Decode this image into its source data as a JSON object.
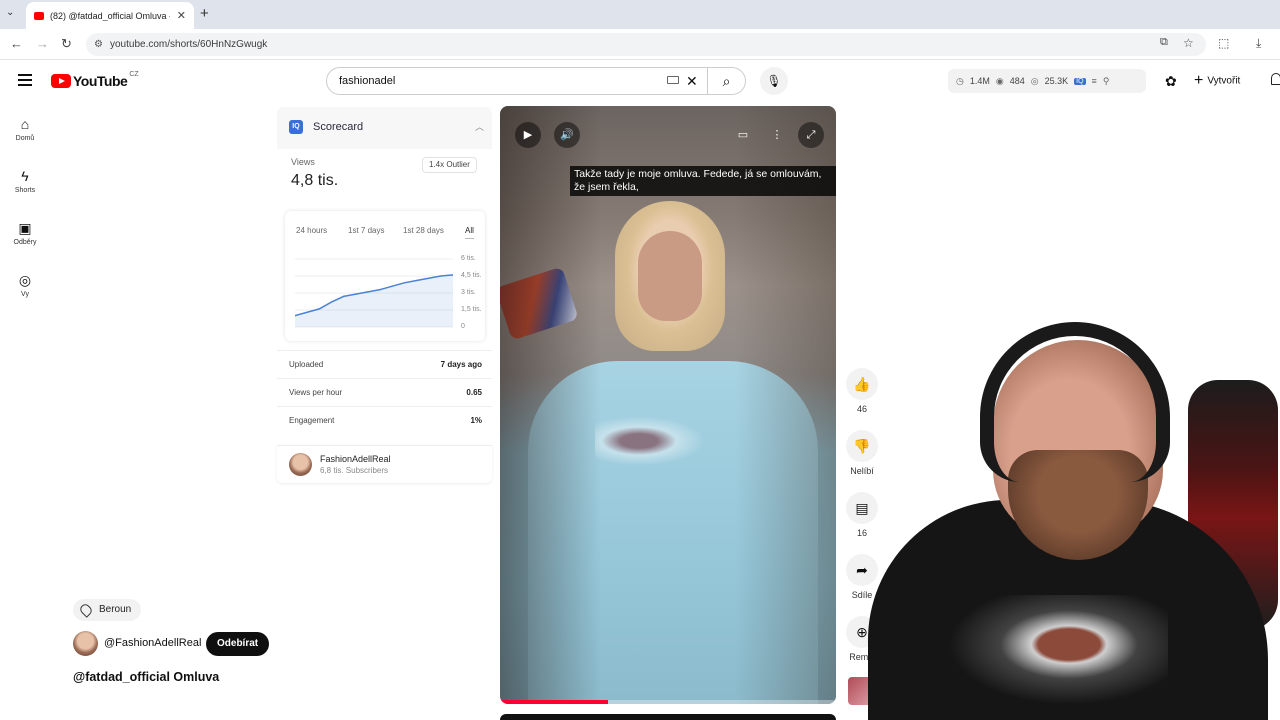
{
  "browser": {
    "tab_title": "(82) @fatdad_official Omluva -",
    "url": "youtube.com/shorts/60HnNzGwugk"
  },
  "header": {
    "logo_text": "YouTube",
    "region": "CZ",
    "search_value": "fashionadel",
    "stats": {
      "views": "1.4M",
      "eye": "484",
      "watch": "25.3K"
    },
    "create_label": "Vytvořit"
  },
  "sidebar": {
    "items": [
      {
        "label": "Domů",
        "icon": "home-icon"
      },
      {
        "label": "Shorts",
        "icon": "shorts-icon"
      },
      {
        "label": "Odběry",
        "icon": "subscriptions-icon"
      },
      {
        "label": "Vy",
        "icon": "you-icon"
      }
    ]
  },
  "scorecard": {
    "title": "Scorecard",
    "views_label": "Views",
    "views_value": "4,8 tis.",
    "outlier": "1.4x Outlier",
    "tabs": [
      "24 hours",
      "1st 7 days",
      "1st 28 days",
      "All"
    ],
    "active_tab": "All",
    "rows": [
      {
        "key": "Uploaded",
        "value": "7 days ago"
      },
      {
        "key": "Views per hour",
        "value": "0.65"
      },
      {
        "key": "Engagement",
        "value": "1%"
      }
    ],
    "channel_name": "FashionAdellReal",
    "channel_subs": "6,8 tis. Subscribers"
  },
  "chart_data": {
    "type": "area",
    "x": [
      1,
      2,
      3,
      4,
      5,
      6,
      7,
      8,
      9,
      10,
      11,
      12,
      13,
      14
    ],
    "series": [
      {
        "values": [
          1.0,
          1.3,
          1.6,
          2.2,
          2.7,
          2.9,
          3.1,
          3.3,
          3.6,
          3.9,
          4.1,
          4.3,
          4.5,
          4.6
        ]
      }
    ],
    "yticks": [
      "6 tis.",
      "4,5 tis.",
      "3 tis.",
      "1,5 tis.",
      "0"
    ],
    "ylim": [
      0,
      6
    ],
    "color": "#4a82d6"
  },
  "video": {
    "caption": "Takže tady je moje omluva. Fedede, já se omlouvám, že jsem řekla,",
    "progress": 0.32
  },
  "actions": [
    {
      "icon": "like-icon",
      "label": "46"
    },
    {
      "icon": "dislike-icon",
      "label": "Nelíbí"
    },
    {
      "icon": "comment-icon",
      "label": "16"
    },
    {
      "icon": "share-icon",
      "label": "Sdíle"
    },
    {
      "icon": "remix-icon",
      "label": "Remix"
    }
  ],
  "meta": {
    "location": "Beroun",
    "owner": "@FashionAdellReal",
    "subscribe_label": "Odebírat",
    "title": "@fatdad_official Omluva"
  }
}
